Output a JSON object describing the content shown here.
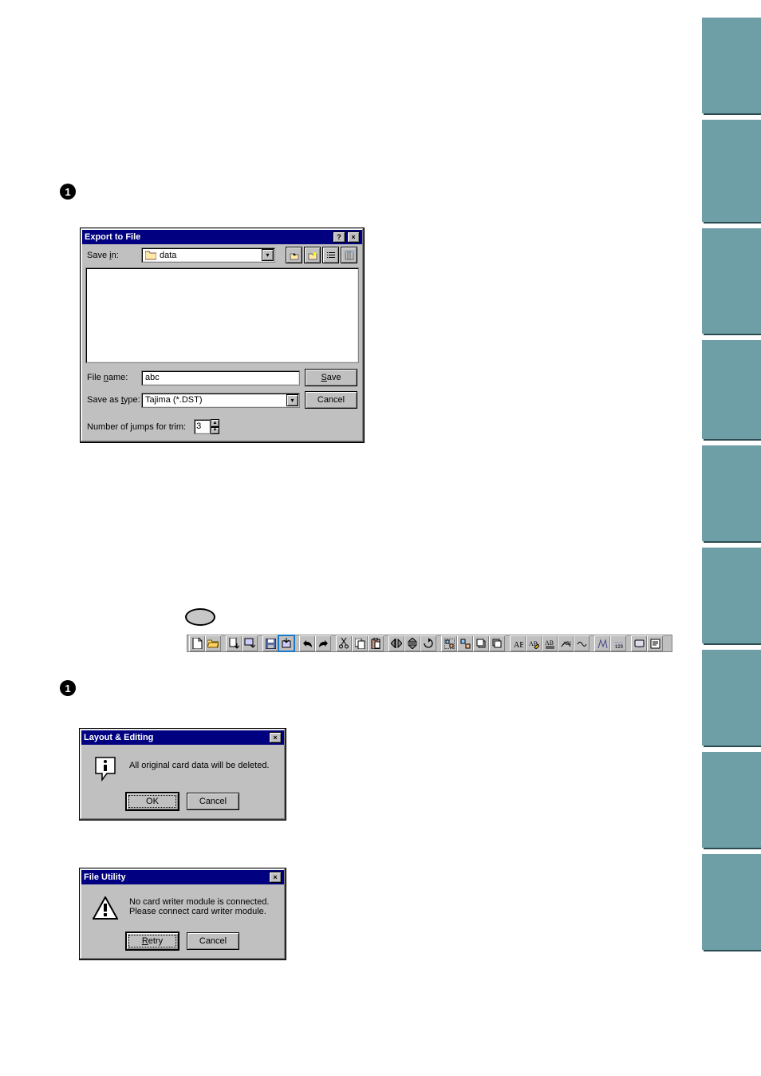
{
  "bullets": {
    "one": "1"
  },
  "export": {
    "title": "Export to File",
    "savein_label": "Save in:",
    "savein_value": "data",
    "filename_label": "File name:",
    "filename_value": "abc",
    "savetype_label": "Save as type:",
    "savetype_value": "Tajima (*.DST)",
    "jumps_label": "Number of jumps for trim:",
    "jumps_value": "3",
    "save_btn": "Save",
    "cancel_btn": "Cancel"
  },
  "layout": {
    "title": "Layout & Editing",
    "message": "All original card data will be deleted.",
    "ok": "OK",
    "cancel": "Cancel"
  },
  "futil": {
    "title": "File Utility",
    "line1": "No card writer module is connected.",
    "line2": "Please connect card writer module.",
    "retry": "Retry",
    "cancel": "Cancel"
  },
  "help": "?",
  "close": "×"
}
